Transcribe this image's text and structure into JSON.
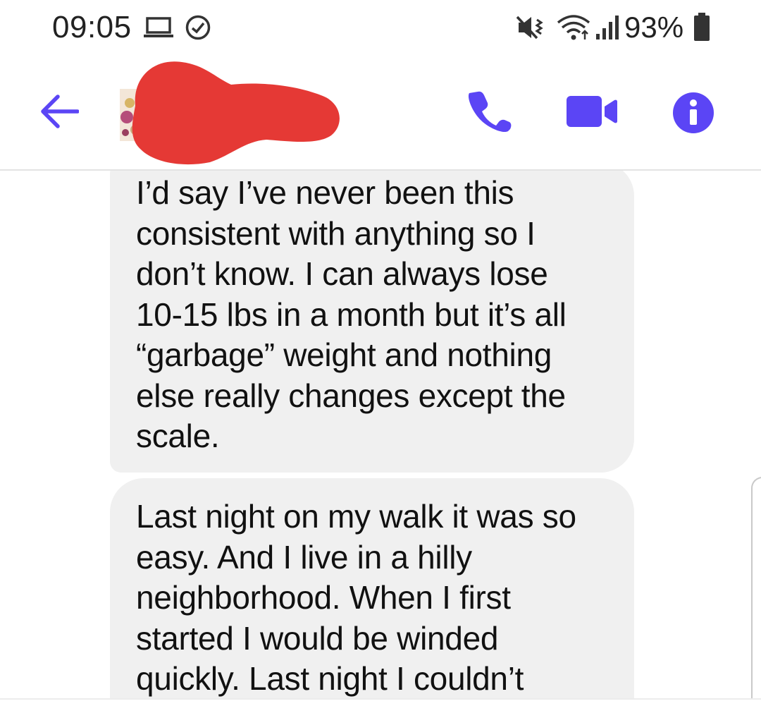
{
  "status_bar": {
    "time": "09:05",
    "battery": "93%",
    "icons": [
      "laptop-icon",
      "messenger-status-icon",
      "mute-vibrate-icon",
      "wifi-icon",
      "signal-icon",
      "battery-icon"
    ]
  },
  "header": {
    "back_icon": "arrow-left-icon",
    "call_icon": "phone-icon",
    "video_icon": "video-camera-icon",
    "info_icon": "info-icon",
    "accent_color": "#5b45f5",
    "redaction_color": "#e53935"
  },
  "messages": [
    {
      "text": "I’d say I’ve never been this\nconsistent with anything so I\ndon’t know.  I can always lose\n10-15 lbs in a month but it’s all\n“garbage” weight and nothing\nelse really changes except the\nscale."
    },
    {
      "text": "Last night on my walk it was so\neasy.  And I live in a hilly\nneighborhood.  When I first\nstarted I would be winded\nquickly.  Last night I couldn’t"
    }
  ],
  "colors": {
    "bubble_background": "#f0f0f0",
    "text": "#111111"
  }
}
